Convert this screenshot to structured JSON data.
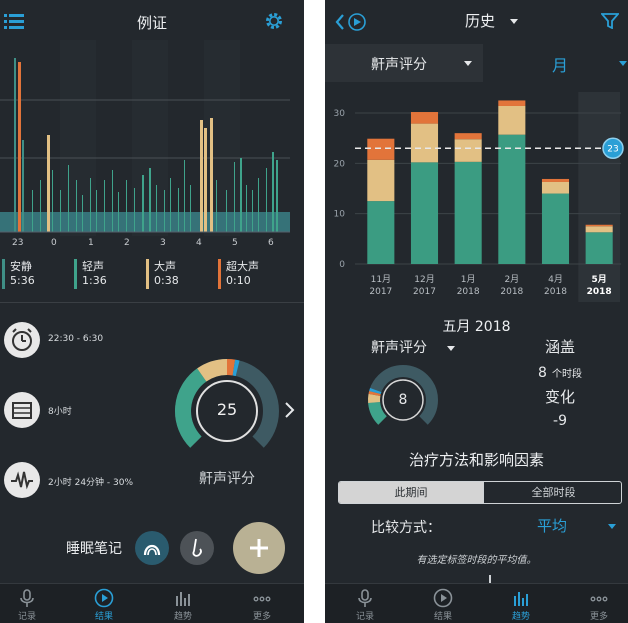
{
  "left": {
    "title": "例证",
    "axis_ticks": [
      "23",
      "0",
      "1",
      "2",
      "3",
      "4",
      "5",
      "6"
    ],
    "legend": [
      {
        "label": "安静",
        "value": "5:36",
        "color": "#3f8f86"
      },
      {
        "label": "轻声",
        "value": "1:36",
        "color": "#3fa38b"
      },
      {
        "label": "大声",
        "value": "0:38",
        "color": "#e2c084"
      },
      {
        "label": "超大声",
        "value": "0:10",
        "color": "#e2743a"
      }
    ],
    "stats": [
      {
        "text": "22:30 - 6:30"
      },
      {
        "text": "8小时"
      },
      {
        "text": "2小时 24分钟 - 30%"
      }
    ],
    "score": {
      "value": "25",
      "label": "鼾声评分"
    },
    "notes_label": "睡眠笔记",
    "tabs": [
      {
        "label": "记录",
        "active": false
      },
      {
        "label": "结果",
        "active": true
      },
      {
        "label": "趋势",
        "active": false
      },
      {
        "label": "更多",
        "active": false
      }
    ]
  },
  "right": {
    "title": "历史",
    "metric_select": "鼾声评分",
    "period_select": "月",
    "avg_badge": "23",
    "month_title": "五月 2018",
    "metric2": "鼾声评分",
    "score": "8",
    "coverage_label": "涵盖",
    "coverage_value": "8",
    "coverage_unit": "个时段",
    "change_label": "变化",
    "change_value": "-9",
    "factors_title": "治疗方法和影响因素",
    "segment": [
      "此期间",
      "全部时段"
    ],
    "compare_label": "比较方式：",
    "compare_value": "平均",
    "hint": "有选定标签时段的平均值。",
    "tabs": [
      {
        "label": "记录",
        "active": false
      },
      {
        "label": "结果",
        "active": false
      },
      {
        "label": "趋势",
        "active": true
      },
      {
        "label": "更多",
        "active": false
      }
    ]
  },
  "chart_data": {
    "type": "bar",
    "categories": [
      [
        "11月",
        "2017"
      ],
      [
        "12月",
        "2017"
      ],
      [
        "1月",
        "2018"
      ],
      [
        "2月",
        "2018"
      ],
      [
        "4月",
        "2018"
      ],
      [
        "5月",
        "2018"
      ]
    ],
    "series": [
      {
        "values": [
          12.5,
          20.2,
          20.3,
          25.7,
          14,
          6.3
        ],
        "color": "#3b9c82"
      },
      {
        "values": [
          8.2,
          7.7,
          4.5,
          5.7,
          2.3,
          1.2
        ],
        "color": "#e2c084"
      },
      {
        "values": [
          4.2,
          2.3,
          1.2,
          1.1,
          0.6,
          0.3
        ],
        "color": "#e2743a"
      }
    ],
    "yticks": [
      0,
      10,
      20,
      30
    ],
    "ylim": [
      0,
      31
    ],
    "average_line": 23,
    "highlight_index": 5,
    "xlabel": "",
    "ylabel": ""
  }
}
